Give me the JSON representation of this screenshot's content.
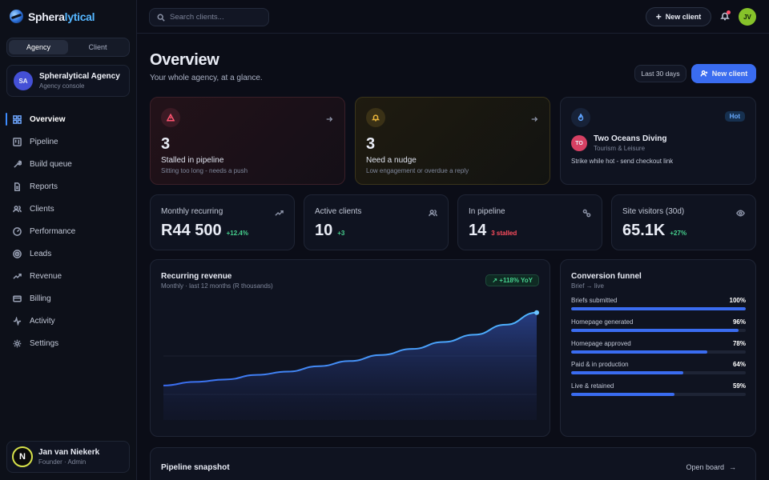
{
  "brand": {
    "name_part1": "Sphera",
    "name_part2": "lytical"
  },
  "mode_toggle": {
    "options": [
      "Agency",
      "Client"
    ],
    "selected": "Agency"
  },
  "org": {
    "initials": "SA",
    "name": "Spheralytical Agency",
    "subtitle": "Agency console"
  },
  "sidebar": {
    "items": [
      {
        "label": "Overview",
        "icon": "grid-icon",
        "active": true
      },
      {
        "label": "Pipeline",
        "icon": "kanban-icon"
      },
      {
        "label": "Build queue",
        "icon": "wrench-icon"
      },
      {
        "label": "Reports",
        "icon": "document-icon"
      },
      {
        "label": "Clients",
        "icon": "users-icon"
      },
      {
        "label": "Performance",
        "icon": "gauge-icon"
      },
      {
        "label": "Leads",
        "icon": "target-icon"
      },
      {
        "label": "Revenue",
        "icon": "trending-up-icon"
      },
      {
        "label": "Billing",
        "icon": "credit-card-icon"
      },
      {
        "label": "Activity",
        "icon": "pulse-icon"
      },
      {
        "label": "Settings",
        "icon": "gear-icon"
      }
    ]
  },
  "user": {
    "initial": "N",
    "name": "Jan van Niekerk",
    "role": "Founder · Admin"
  },
  "topbar": {
    "search_placeholder": "Search clients...",
    "new_client": "New client",
    "avatar_initials": "JV"
  },
  "header": {
    "title": "Overview",
    "subtitle": "Your whole agency, at a glance.",
    "range": "Last 30 days",
    "new_client": "New client"
  },
  "alerts": {
    "stalled": {
      "count": "3",
      "label": "Stalled in pipeline",
      "sub": "Sitting too long - needs a push"
    },
    "nudge": {
      "count": "3",
      "label": "Need a nudge",
      "sub": "Low engagement or overdue a reply"
    },
    "hot": {
      "badge": "Hot",
      "initials": "TO",
      "name": "Two Oceans Diving",
      "category": "Tourism & Leisure",
      "note": "Strike while hot - send checkout link"
    }
  },
  "stats": [
    {
      "label": "Monthly recurring",
      "value": "R44 500",
      "delta": "+12.4%",
      "delta_color": "#46d18e",
      "icon": "trending-up-icon"
    },
    {
      "label": "Active clients",
      "value": "10",
      "delta": "+3",
      "delta_color": "#46d18e",
      "icon": "users-icon"
    },
    {
      "label": "In pipeline",
      "value": "14",
      "delta": "3 stalled",
      "delta_color": "#ff4d5e",
      "icon": "link-icon"
    },
    {
      "label": "Site visitors (30d)",
      "value": "65.1K",
      "delta": "+27%",
      "delta_color": "#46d18e",
      "icon": "eye-icon"
    }
  ],
  "revenue": {
    "title": "Recurring revenue",
    "subtitle": "Monthly · last 12 months (R thousands)",
    "yoy": "+118% YoY"
  },
  "chart_data": {
    "type": "area",
    "title": "Recurring revenue",
    "subtitle": "Monthly · last 12 months (R thousands)",
    "series": [
      {
        "values": [
          20.4,
          21.6,
          22.4,
          23.9,
          25.0,
          26.8,
          28.5,
          30.5,
          32.5,
          34.8,
          37.2,
          40.5,
          44.5
        ]
      }
    ],
    "grid": true
  },
  "funnel": {
    "title": "Conversion funnel",
    "subtitle": "Brief → live",
    "rows": [
      {
        "label": "Briefs submitted",
        "value": "100%",
        "fraction": 1.0
      },
      {
        "label": "Homepage generated",
        "value": "96%",
        "fraction": 0.96
      },
      {
        "label": "Homepage approved",
        "value": "78%",
        "fraction": 0.78
      },
      {
        "label": "Paid & in production",
        "value": "64%",
        "fraction": 0.64
      },
      {
        "label": "Live & retained",
        "value": "59%",
        "fraction": 0.59
      }
    ]
  },
  "pipeline": {
    "title": "Pipeline snapshot",
    "link": "Open board"
  }
}
